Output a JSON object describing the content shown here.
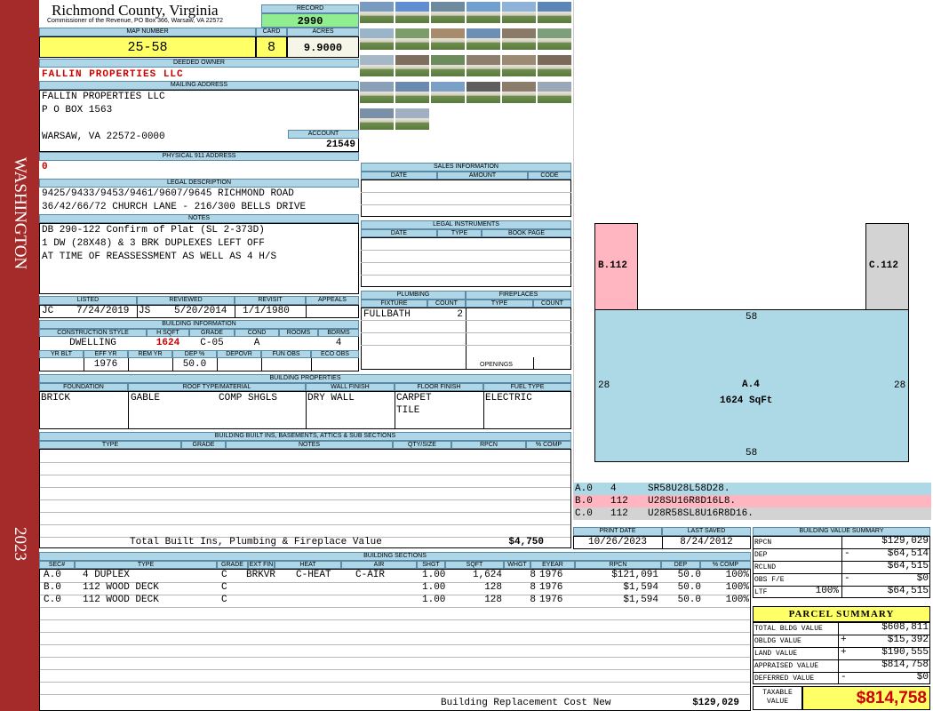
{
  "sidebar": {
    "district": "WASHINGTON",
    "year": "2023"
  },
  "header": {
    "county": "Richmond County, Virginia",
    "office": "Commissioner of the Revenue, PO Box 366, Warsaw, VA 22572"
  },
  "record": {
    "label": "RECORD",
    "value": "2990"
  },
  "map": {
    "map_label": "MAP NUMBER",
    "map_value": "25-58",
    "card_label": "CARD",
    "card_value": "8",
    "acres_label": "ACRES",
    "acres_value": "9.9000"
  },
  "owner": {
    "label": "DEEDED OWNER",
    "value": "FALLIN PROPERTIES LLC"
  },
  "mailing": {
    "label": "MAILING ADDRESS",
    "line1": "FALLIN PROPERTIES LLC",
    "line2": "P O BOX 1563",
    "line3": "WARSAW, VA 22572-0000",
    "account_label": "ACCOUNT",
    "account_value": "21549"
  },
  "physical": {
    "label": "PHYSICAL 911 ADDRESS",
    "value": "0"
  },
  "legal": {
    "label": "LEGAL DESCRIPTION",
    "line1": "9425/9433/9453/9461/9607/9645 RICHMOND ROAD",
    "line2": "36/42/66/72 CHURCH LANE - 216/300 BELLS DRIVE"
  },
  "notes": {
    "label": "NOTES",
    "line1": "DB 290-122 Confirm of Plat (SL 2-373D)",
    "line2": "1 DW (28X48) & 3 BRK DUPLEXES LEFT OFF",
    "line3": "AT TIME OF REASSESSMENT AS WELL AS 4 H/S"
  },
  "listing": {
    "listed_label": "LISTED",
    "listed_by": "JC",
    "listed_date": "7/24/2019",
    "reviewed_label": "REVIEWED",
    "reviewed_by": "JS",
    "reviewed_date": "5/20/2014",
    "revisit_label": "REVISIT",
    "revisit_date": "1/1/1980",
    "appeals_label": "APPEALS"
  },
  "building_info": {
    "label": "BUILDING INFORMATION",
    "h1": "CONSTRUCTION STYLE",
    "h2": "H SQFT",
    "h3": "GRADE",
    "h4": "COND",
    "h5": "ROOMS",
    "h6": "BDRMS",
    "style": "DWELLING",
    "hsqft": "1624",
    "grade": "C-05",
    "cond": "A",
    "rooms": "",
    "bdrms": "4",
    "k1": "YR BLT",
    "k2": "EFF YR",
    "k3": "REM YR",
    "k4": "DEP %",
    "k5": "DEPOVR",
    "k6": "FUN OBS",
    "k7": "ECO OBS",
    "yr_blt": "",
    "eff_yr": "1976",
    "rem_yr": "",
    "dep": "50.0"
  },
  "sales": {
    "label": "SALES INFORMATION",
    "c1": "DATE",
    "c2": "AMOUNT",
    "c3": "CODE"
  },
  "instruments": {
    "label": "LEGAL INSTRUMENTS",
    "c1": "DATE",
    "c2": "TYPE",
    "c3": "BOOK PAGE"
  },
  "plumbing": {
    "label": "PLUMBING",
    "c1": "FIXTURE",
    "c2": "COUNT",
    "fixture": "FULLBATH",
    "count": "2"
  },
  "fireplaces": {
    "label": "FIREPLACES",
    "c1": "TYPE",
    "c2": "COUNT",
    "openings": "OPENINGS"
  },
  "properties": {
    "label": "BUILDING PROPERTIES",
    "c1": "FOUNDATION",
    "c2": "ROOF TYPE/MATERIAL",
    "c3": "WALL FINISH",
    "c4": "FLOOR FINISH",
    "c5": "FUEL TYPE",
    "foundation": "BRICK",
    "roof_type": "GABLE",
    "roof_mat": "COMP SHGLS",
    "wall": "DRY WALL",
    "floor1": "CARPET",
    "floor2": "TILE",
    "fuel": "ELECTRIC"
  },
  "builtins": {
    "label": "BUILDING BUILT INS, BASEMENTS, ATTICS & SUB SECTIONS",
    "c1": "TYPE",
    "c2": "GRADE",
    "c3": "NOTES",
    "c4": "QTY/SIZE",
    "c5": "RPCN",
    "c6": "% COMP",
    "total_label": "Total Built Ins, Plumbing & Fireplace Value",
    "total_value": "$4,750"
  },
  "sketch": {
    "b_label": "B.112",
    "c_label": "C.112",
    "a_label": "A.4",
    "a_area": "1624 SqFt",
    "top": "58",
    "bottom": "58",
    "left": "28",
    "right": "28"
  },
  "sketch_legend": [
    {
      "id": "A.0",
      "num": "4",
      "code": "SR58U28L58D28.",
      "color": "#add8e6"
    },
    {
      "id": "B.0",
      "num": "112",
      "code": "U28SU16R8D16L8.",
      "color": "#ffb6c1"
    },
    {
      "id": "C.0",
      "num": "112",
      "code": "U28R58SL8U16R8D16.",
      "color": "#d3d3d3"
    }
  ],
  "print": {
    "print_label": "PRINT DATE",
    "print_date": "10/26/2023",
    "saved_label": "LAST SAVED",
    "saved_date": "8/24/2012"
  },
  "sections": {
    "label": "BUILDING SECTIONS",
    "headers": [
      "SEC#",
      "TYPE",
      "GRADE",
      "EXT FIN",
      "HEAT",
      "AIR",
      "SHGT",
      "SQFT",
      "WHGT",
      "EYEAR",
      "RPCN",
      "DEP",
      "% COMP"
    ],
    "rows": [
      [
        "A.0",
        "4 DUPLEX",
        "C",
        "BRKVR",
        "C-HEAT",
        "C-AIR",
        "1.00",
        "1,624",
        "8",
        "1976",
        "$121,091",
        "50.0",
        "100%"
      ],
      [
        "B.0",
        "112 WOOD DECK",
        "C",
        "",
        "",
        "",
        "1.00",
        "128",
        "8",
        "1976",
        "$1,594",
        "50.0",
        "100%"
      ],
      [
        "C.0",
        "112 WOOD DECK",
        "C",
        "",
        "",
        "",
        "1.00",
        "128",
        "8",
        "1976",
        "$1,594",
        "50.0",
        "100%"
      ]
    ],
    "replacement_label": "Building Replacement Cost New",
    "replacement_value": "$129,029"
  },
  "value_summary": {
    "label": "BUILDING VALUE SUMMARY",
    "rpcn_label": "RPCN",
    "rpcn": "$129,029",
    "dep_label": "DEP",
    "dep_sign": "-",
    "dep": "$64,514",
    "rclnd_label": "RCLND",
    "rclnd": "$64,515",
    "obs_label": "OBS F/E",
    "obs_sign": "-",
    "obs": "$0",
    "ltf_label": "LTF",
    "ltf_pct": "100%",
    "ltf": "$64,515"
  },
  "parcel": {
    "label": "PARCEL SUMMARY",
    "total_bldg_label": "TOTAL BLDG VALUE",
    "total_bldg": "$608,811",
    "obldg_label": "OBLDG VALUE",
    "obldg_sign": "+",
    "obldg": "$15,392",
    "land_label": "LAND VALUE",
    "land_sign": "+",
    "land": "$190,555",
    "appraised_label": "APPRAISED VALUE",
    "appraised": "$814,758",
    "deferred_label": "DEFERRED VALUE",
    "deferred_sign": "-",
    "deferred": "$0",
    "taxable_label1": "TAXABLE",
    "taxable_label2": "VALUE",
    "taxable": "$814,758"
  },
  "photos": {
    "colors": [
      "#7a9bc0",
      "#5f8fd0",
      "#6d8a9e",
      "#6fa0cf",
      "#8fb2d8",
      "#5c86b8",
      "#9ab4c8",
      "#7c9c6a",
      "#a78b6d",
      "#6e8fb5",
      "#8a7a68",
      "#7d9f7b",
      "#a5b8c8",
      "#7e6e5e",
      "#6c8c5c",
      "#8e7e6e",
      "#9c8a72",
      "#7b6a5a",
      "#8aa0b8",
      "#6a8ab0",
      "#7aa0c8",
      "#5e5e5e",
      "#8c7c6c",
      "#9aa8b8",
      "#7a90a8",
      "#a0b0c0"
    ]
  }
}
